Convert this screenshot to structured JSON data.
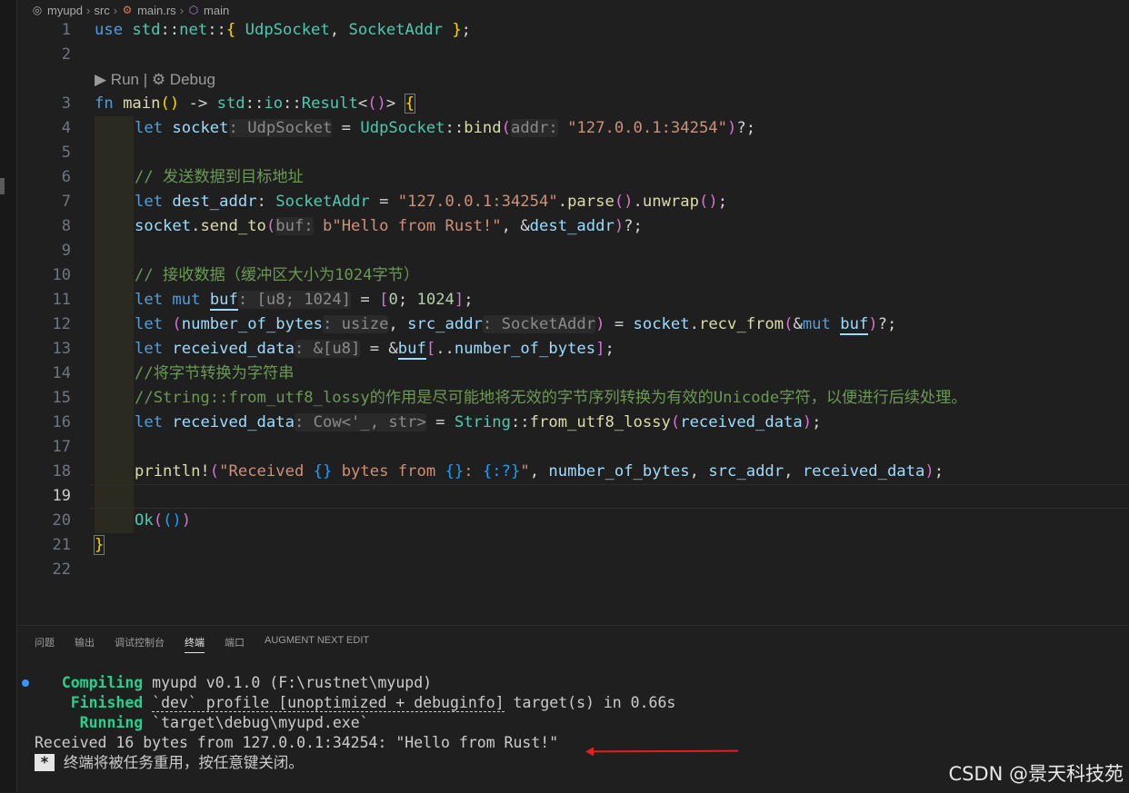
{
  "breadcrumb": [
    "myupd",
    "src",
    "main.rs",
    "main"
  ],
  "codelens": "▶ Run | ⚙ Debug",
  "current_line": 19,
  "line_numbers": [
    "1",
    "2",
    "3",
    "4",
    "5",
    "6",
    "7",
    "8",
    "9",
    "10",
    "11",
    "12",
    "13",
    "14",
    "15",
    "16",
    "17",
    "18",
    "19",
    "20",
    "21",
    "22"
  ],
  "code": {
    "l1": [
      "use",
      " ",
      "std",
      "::",
      "net",
      "::",
      "{",
      " ",
      "UdpSocket",
      ", ",
      "SocketAddr",
      " ",
      "}",
      ";"
    ],
    "l3": [
      "fn",
      " ",
      "main",
      "(",
      ")",
      " -> ",
      "std",
      "::",
      "io",
      "::",
      "Result",
      "<",
      "()",
      ">",
      " ",
      "{"
    ],
    "l4": [
      "let",
      " ",
      "socket",
      ": UdpSocket",
      " = ",
      "UdpSocket",
      "::",
      "bind",
      "(",
      "addr:",
      " ",
      "\"127.0.0.1:34254\"",
      ")",
      "?;"
    ],
    "l6": "// 发送数据到目标地址",
    "l7": [
      "let",
      " ",
      "dest_addr",
      ": ",
      "SocketAddr",
      " = ",
      "\"127.0.0.1:34254\"",
      ".",
      "parse",
      "(",
      ")",
      ".",
      "unwrap",
      "(",
      ")",
      ";"
    ],
    "l8": [
      "socket",
      ".",
      "send_to",
      "(",
      "buf:",
      " ",
      "b\"Hello from Rust!\"",
      ", &",
      "dest_addr",
      ")",
      "?;"
    ],
    "l10": "// 接收数据（缓冲区大小为1024字节）",
    "l11": [
      "let",
      " ",
      "mut",
      " ",
      "buf",
      ": [u8; 1024]",
      " = ",
      "[",
      "0",
      "; ",
      "1024",
      "]",
      ";"
    ],
    "l12": [
      "let",
      " ",
      "(",
      "number_of_bytes",
      ": usize",
      ", ",
      "src_addr",
      ": SocketAddr",
      ")",
      " = ",
      "socket",
      ".",
      "recv_from",
      "(",
      "&",
      "mut",
      " ",
      "buf",
      ")",
      "?;"
    ],
    "l13": [
      "let",
      " ",
      "received_data",
      ": &[u8]",
      " = &",
      "buf",
      "[",
      "..",
      "number_of_bytes",
      "]",
      ";"
    ],
    "l14": "//将字节转换为字符串",
    "l15": "//String::from_utf8_lossy的作用是尽可能地将无效的字节序列转换为有效的Unicode字符，以便进行后续处理。",
    "l16": [
      "let",
      " ",
      "received_data",
      ": Cow<'_, str>",
      " = ",
      "String",
      "::",
      "from_utf8_lossy",
      "(",
      "received_data",
      ")",
      ";"
    ],
    "l18": [
      "println!",
      "(",
      "\"Received ",
      "{}",
      " bytes from ",
      "{}",
      ": ",
      "{:?}",
      "\"",
      ", ",
      "number_of_bytes",
      ", ",
      "src_addr",
      ", ",
      "received_data",
      ")",
      ";"
    ],
    "l20": [
      "Ok",
      "(",
      "(",
      ")",
      ")"
    ],
    "l21": "}"
  },
  "panel": {
    "tabs": [
      "问题",
      "输出",
      "调试控制台",
      "终端",
      "端口",
      "AUGMENT NEXT EDIT"
    ],
    "active_tab": "终端"
  },
  "terminal": {
    "compiling_label": "Compiling",
    "compiling_text": " myupd v0.1.0 (F:\\rustnet\\myupd)",
    "finished_label": "Finished",
    "finished_profile": "`dev` profile [unoptimized + debuginfo]",
    "finished_text": " target(s) in 0.66s",
    "running_label": "Running",
    "running_text": " `target\\debug\\myupd.exe`",
    "output": "Received 16 bytes from 127.0.0.1:34254: \"Hello from Rust!\"",
    "badge": "*",
    "notice": "终端将被任务重用，按任意键关闭。"
  },
  "watermark": "CSDN @景天科技苑",
  "colors": {
    "accent": "#3794ff",
    "arrow": "#e02020",
    "success": "#23d18b"
  }
}
